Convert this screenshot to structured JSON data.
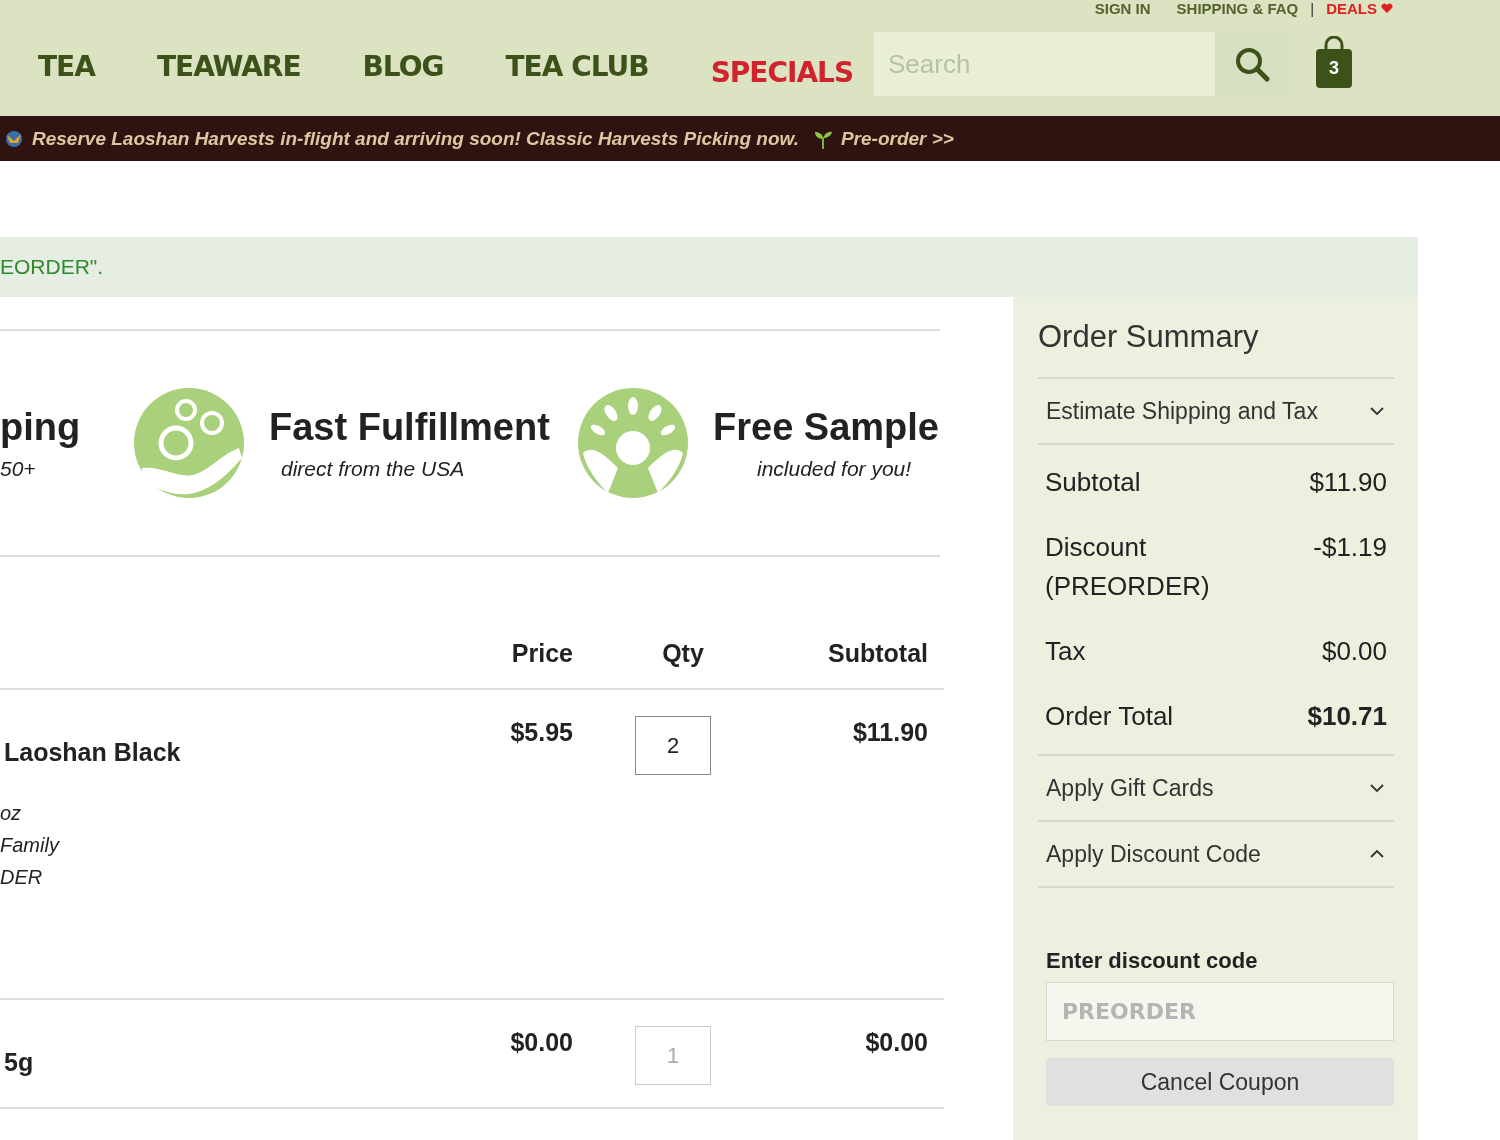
{
  "header": {
    "top_links": [
      {
        "label": "SIGN IN",
        "kind": "link"
      },
      {
        "label": "SHIPPING & FAQ",
        "kind": "link"
      },
      {
        "label": "|",
        "kind": "separator"
      },
      {
        "label": "DEALS",
        "kind": "deal"
      }
    ],
    "nav": [
      {
        "label": "TEA",
        "highlight": false
      },
      {
        "label": "TEAWARE",
        "highlight": false
      },
      {
        "label": "BLOG",
        "highlight": false
      },
      {
        "label": "TEA CLUB",
        "highlight": false
      },
      {
        "label": "SPECIALS",
        "highlight": true
      }
    ],
    "search": {
      "placeholder": "Search"
    },
    "cart": {
      "count": "3"
    }
  },
  "banner": {
    "text": "Reserve Laoshan Harvests in-flight and arriving soon! Classic Harvests Picking now.",
    "link": "Pre-order >>"
  },
  "notice": {
    "text": "EORDER\"."
  },
  "features": [
    {
      "title": "ping",
      "subtitle": "50+",
      "kind": "none"
    },
    {
      "title": "Fast Fulfillment",
      "subtitle": "direct from the USA",
      "kind": "hand"
    },
    {
      "title": "Free Sample",
      "subtitle": "included for you!",
      "kind": "sprout"
    }
  ],
  "cart_table": {
    "columns": [
      "Price",
      "Qty",
      "Subtotal"
    ],
    "rows": [
      {
        "name": "Laoshan Black",
        "options": [
          "oz",
          "Family",
          "DER"
        ],
        "price": "$5.95",
        "qty": "2",
        "subtotal": "$11.90",
        "disabled": false
      },
      {
        "name": "5g",
        "price": "$0.00",
        "qty": "1",
        "subtotal": "$0.00",
        "disabled": true
      }
    ]
  },
  "summary": {
    "title": "Order Summary",
    "top_sections": [
      {
        "label": "Estimate Shipping and Tax",
        "expanded": false
      }
    ],
    "lines": [
      {
        "label": "Subtotal",
        "value": "$11.90",
        "kind": "normal"
      },
      {
        "label": "Discount (PREORDER)",
        "value": "-$1.19",
        "kind": "normal"
      },
      {
        "label": "Tax",
        "value": "$0.00",
        "kind": "normal"
      },
      {
        "label": "Order Total",
        "value": "$10.71",
        "kind": "total"
      }
    ],
    "bottom_sections": [
      {
        "label": "Apply Gift Cards",
        "expanded": false
      },
      {
        "label": "Apply Discount Code",
        "expanded": true
      }
    ],
    "discount": {
      "label": "Enter discount code",
      "value": "PREORDER",
      "disabled": true,
      "button": "Cancel Coupon"
    }
  }
}
